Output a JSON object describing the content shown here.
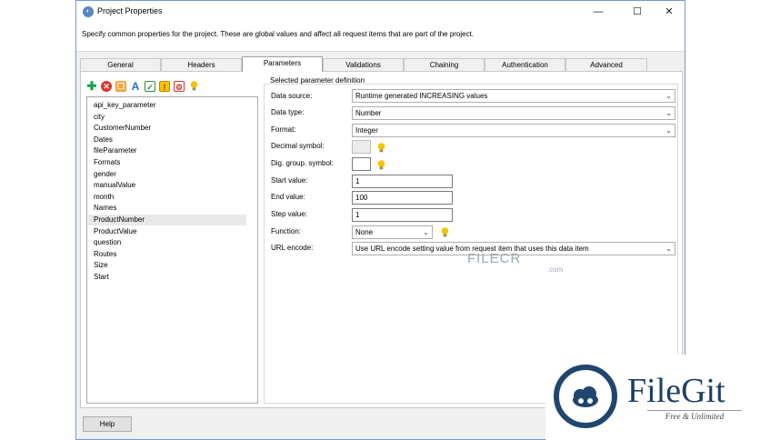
{
  "window": {
    "title": "Project Properties",
    "description": "Specify common properties for the project. These are global values and affect all request items that are part of the project."
  },
  "tabs": [
    {
      "label": "General"
    },
    {
      "label": "Headers"
    },
    {
      "label": "Parameters"
    },
    {
      "label": "Validations"
    },
    {
      "label": "Chaining"
    },
    {
      "label": "Authentication"
    },
    {
      "label": "Advanced"
    }
  ],
  "active_tab": "Parameters",
  "parameters": {
    "list": [
      "api_key_parameter",
      "city",
      "CustomerNumber",
      "Dates",
      "fileParameter",
      "Formats",
      "gender",
      "manualValue",
      "month",
      "Names",
      "ProductNumber",
      "ProductValue",
      "question",
      "Routes",
      "Size",
      "Start"
    ],
    "selected": "ProductNumber"
  },
  "definition": {
    "section_title": "Selected parameter definition",
    "labels": {
      "data_source": "Data source:",
      "data_type": "Data type:",
      "format": "Format:",
      "decimal_symbol": "Decimal symbol:",
      "dig_group_symbol": "Dig. group. symbol:",
      "start_value": "Start value:",
      "end_value": "End value:",
      "step_value": "Step value:",
      "function": "Function:",
      "url_encode": "URL encode:"
    },
    "values": {
      "data_source": "Runtime generated INCREASING values",
      "data_type": "Number",
      "format": "Integer",
      "start_value": "1",
      "end_value": "100",
      "step_value": "1",
      "function": "None",
      "url_encode": "Use URL encode setting value from request item that uses this data item"
    }
  },
  "buttons": {
    "help": "Help"
  },
  "watermarks": {
    "filecr": "FILECR",
    "filecr_com": ".com",
    "filegit": "FileGit",
    "filegit_tagline": "Free & Unlimited"
  },
  "colors": {
    "window_border": "#6e9ad0",
    "panel_bg": "#f0f0f0",
    "bulb": "#f5c400"
  }
}
